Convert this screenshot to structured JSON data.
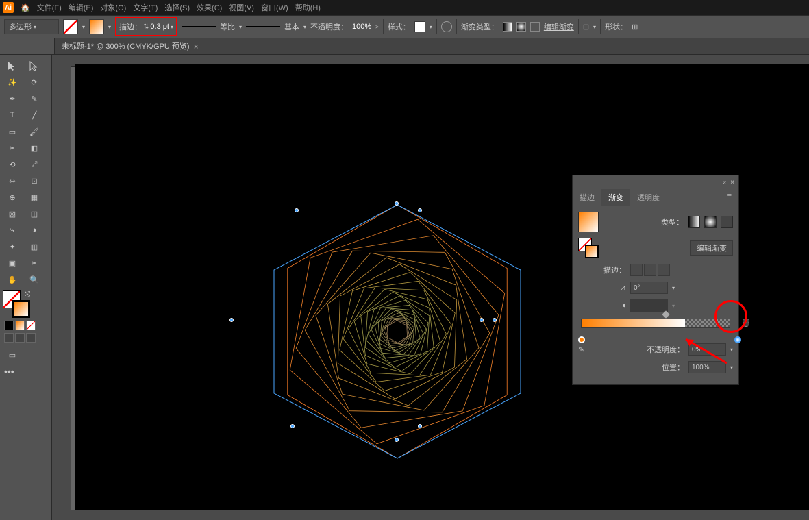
{
  "menubar": {
    "logo": "Ai",
    "items": [
      "文件(F)",
      "编辑(E)",
      "对象(O)",
      "文字(T)",
      "选择(S)",
      "效果(C)",
      "视图(V)",
      "窗口(W)",
      "帮助(H)"
    ]
  },
  "controlbar": {
    "tool_label": "多边形",
    "stroke_label": "描边：",
    "stroke_value": "0.3 pt",
    "profile_label": "等比",
    "brush_label": "基本",
    "opacity_label": "不透明度：",
    "opacity_value": "100%",
    "style_label": "样式：",
    "gradient_type_label": "渐变类型：",
    "edit_gradient_label": "编辑渐变",
    "shape_label": "形状："
  },
  "tab": {
    "title": "未标题-1* @ 300% (CMYK/GPU 预览)"
  },
  "panel": {
    "tabs": {
      "stroke": "描边",
      "gradient": "渐变",
      "transparency": "透明度"
    },
    "type_label": "类型：",
    "edit_label": "编辑渐变",
    "stroke_label": "描边：",
    "angle_value": "0°",
    "opacity_label": "不透明度：",
    "opacity_value": "0%",
    "position_label": "位置：",
    "position_value": "100%"
  }
}
